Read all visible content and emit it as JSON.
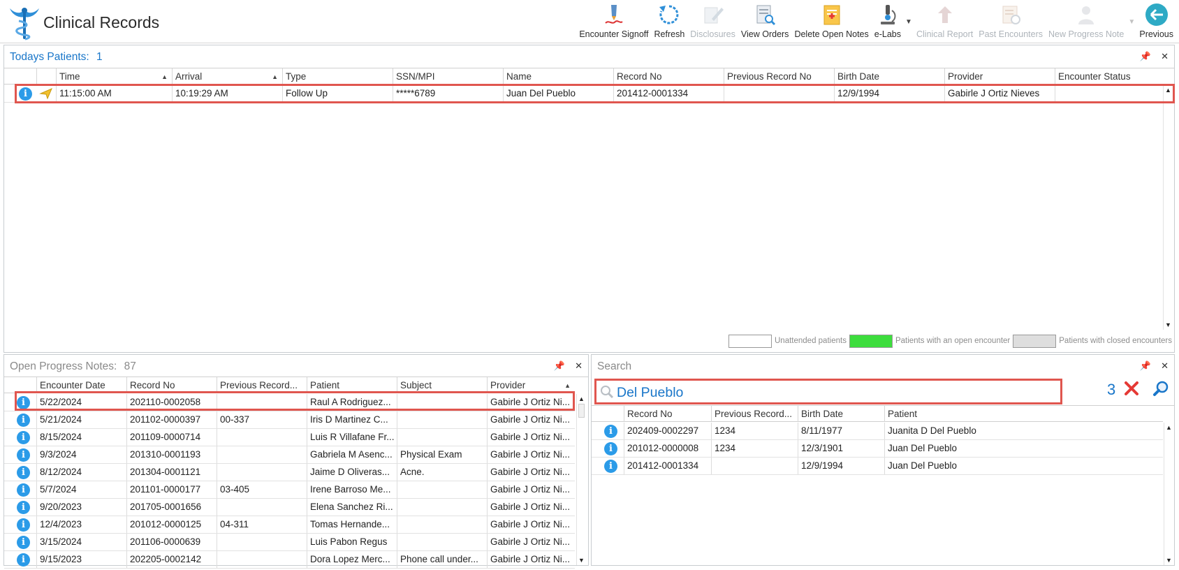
{
  "app": {
    "title": "Clinical Records"
  },
  "toolbar": {
    "buttons": [
      {
        "label": "Encounter Signoff",
        "icon": "signature-pen-icon",
        "enabled": true
      },
      {
        "label": "Refresh",
        "icon": "refresh-icon",
        "enabled": true
      },
      {
        "label": "Disclosures",
        "icon": "disclosures-pencil-icon",
        "enabled": false
      },
      {
        "label": "View Orders",
        "icon": "view-orders-icon",
        "enabled": true
      },
      {
        "label": "Delete Open Notes",
        "icon": "delete-notes-icon",
        "enabled": true
      },
      {
        "label": "e-Labs",
        "icon": "microscope-icon",
        "enabled": true
      },
      {
        "label": "Clinical Report",
        "icon": "clinical-report-icon",
        "enabled": false
      },
      {
        "label": "Past Encounters",
        "icon": "past-encounters-icon",
        "enabled": false
      },
      {
        "label": "New Progress Note",
        "icon": "new-progress-note-icon",
        "enabled": false
      },
      {
        "label": "Previous",
        "icon": "back-arrow-icon",
        "enabled": true
      }
    ]
  },
  "todays": {
    "title": "Todays Patients:",
    "count": "1",
    "columns": [
      "Time",
      "Arrival",
      "Type",
      "SSN/MPI",
      "Name",
      "Record No",
      "Previous Record No",
      "Birth Date",
      "Provider",
      "Encounter Status"
    ],
    "rows": [
      [
        "11:15:00 AM",
        "10:19:29 AM",
        "Follow Up",
        "*****6789",
        "Juan Del Pueblo",
        "201412-0001334",
        "",
        "12/9/1994",
        "Gabirle J Ortiz Nieves",
        ""
      ]
    ]
  },
  "legend": {
    "items": [
      {
        "label": "Unattended patients",
        "color": "#ffffff"
      },
      {
        "label": "Patients with an open encounter",
        "color": "#3ddd3d"
      },
      {
        "label": "Patients with closed encounters",
        "color": "#dedede"
      }
    ]
  },
  "open_notes": {
    "title": "Open Progress Notes:",
    "count": "87",
    "columns": [
      "Encounter Date",
      "Record No",
      "Previous Record...",
      "Patient",
      "Subject",
      "Provider"
    ],
    "rows": [
      [
        "5/22/2024",
        "202110-0002058",
        "",
        "Raul A Rodriguez...",
        "",
        "Gabirle J Ortiz Ni..."
      ],
      [
        "5/21/2024",
        "201102-0000397",
        "00-337",
        "Iris D Martinez C...",
        "",
        "Gabirle J Ortiz Ni..."
      ],
      [
        "8/15/2024",
        "201109-0000714",
        "",
        "Luis R Villafane Fr...",
        "",
        "Gabirle J Ortiz Ni..."
      ],
      [
        "9/3/2024",
        "201310-0001193",
        "",
        "Gabriela M Asenc...",
        "Physical Exam",
        "Gabirle J Ortiz Ni..."
      ],
      [
        "8/12/2024",
        "201304-0001121",
        "",
        "Jaime D Oliveras...",
        "Acne.",
        "Gabirle J Ortiz Ni..."
      ],
      [
        "5/7/2024",
        "201101-0000177",
        "03-405",
        "Irene Barroso Me...",
        "",
        "Gabirle J Ortiz Ni..."
      ],
      [
        "9/20/2023",
        "201705-0001656",
        "",
        "Elena Sanchez Ri...",
        "",
        "Gabirle J Ortiz Ni..."
      ],
      [
        "12/4/2023",
        "201012-0000125",
        "04-311",
        "Tomas Hernande...",
        "",
        "Gabirle J Ortiz Ni..."
      ],
      [
        "3/15/2024",
        "201106-0000639",
        "",
        "Luis Pabon Regus",
        "",
        "Gabirle J Ortiz Ni..."
      ],
      [
        "9/15/2023",
        "202205-0002142",
        "",
        "Dora Lopez Merc...",
        "Phone call under...",
        "Gabirle J Ortiz Ni..."
      ]
    ]
  },
  "search": {
    "title": "Search",
    "query": "Del Pueblo",
    "result_count": "3",
    "columns": [
      "Record No",
      "Previous Record...",
      "Birth Date",
      "Patient"
    ],
    "rows": [
      [
        "202409-0002297",
        "1234",
        "8/11/1977",
        "Juanita D Del Pueblo"
      ],
      [
        "201012-0000008",
        "1234",
        "12/3/1901",
        "Juan Del Pueblo"
      ],
      [
        "201412-0001334",
        "",
        "12/9/1994",
        "Juan Del Pueblo"
      ]
    ]
  },
  "colors": {
    "accent": "#1976c9",
    "highlight_box": "#e0564f",
    "info_icon": "#2b9be8",
    "clear_x": "#e53935"
  }
}
